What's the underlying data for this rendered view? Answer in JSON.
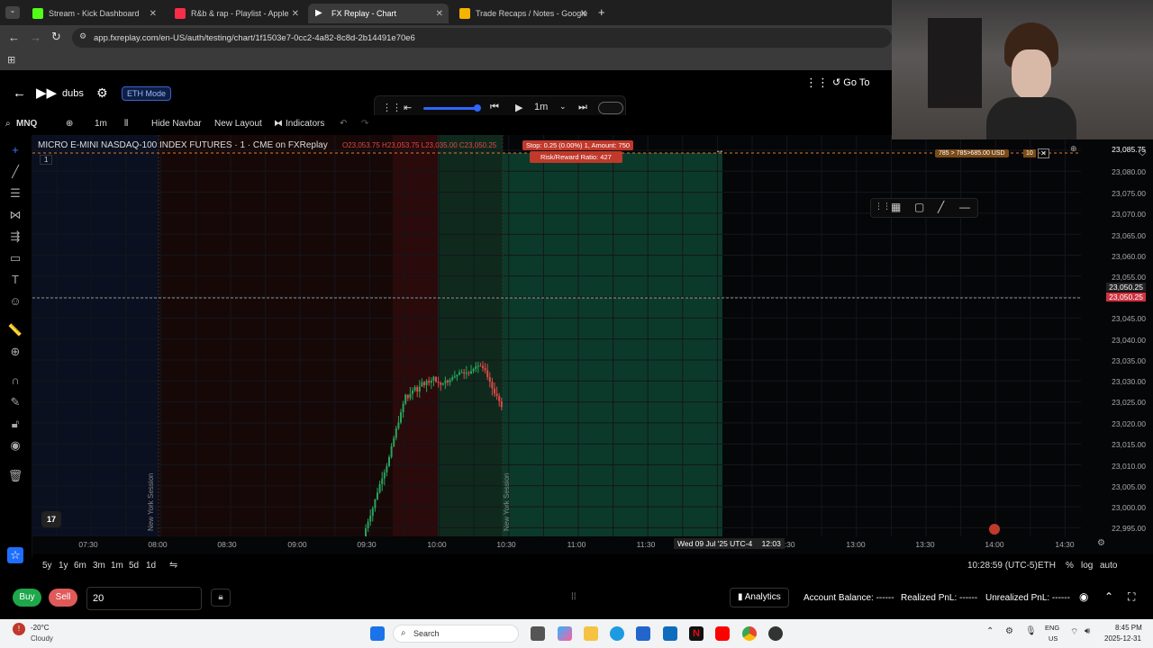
{
  "browser": {
    "tabs": [
      {
        "label": "Stream - Kick Dashboard",
        "color": "#53fc18"
      },
      {
        "label": "R&b & rap - Playlist - Apple",
        "color": "#fa2d48"
      },
      {
        "label": "FX Replay - Chart",
        "color": "#ffffff"
      },
      {
        "label": "Trade Recaps / Notes - Google",
        "color": "#f4b400"
      }
    ],
    "url": "app.fxreplay.com/en-US/auth/testing/chart/1f1503e7-0cc2-4a82-8c8d-2b14491e70e6"
  },
  "app": {
    "user": "dubs",
    "eth_mode": "ETH Mode",
    "goto": "Go To",
    "timeframe": "1m",
    "symbol_short": "MNQ",
    "tf_short": "1m",
    "hide_navbar": "Hide Navbar",
    "new_layout": "New Layout",
    "indicators": "Indicators"
  },
  "chart": {
    "title": "MICRO E-MINI NASDAQ-100 INDEX FUTURES · 1 · CME on FXReplay",
    "ohlc": "O23,053.75 H23,053.75 L23,035.00 C23,050.25",
    "stop_label": "Stop: 0.25 (0.00%) 1, Amount: 750",
    "rr_label": "Risk/Reward Ratio: 427",
    "position_tag": "785 > 785>685.00 USD",
    "qty_tag": "10",
    "session_label_1": "New York Session",
    "session_label_2": "New York Session",
    "pane_index": "1",
    "price_labels": [
      "23,085.75",
      "23,080.00",
      "23,075.00",
      "23,070.00",
      "23,065.00",
      "23,060.00",
      "23,055.00",
      "23,050.25",
      "23,050.25",
      "23,045.00",
      "23,040.00",
      "23,035.00",
      "23,030.00",
      "23,025.00",
      "23,020.00",
      "23,015.00",
      "23,010.00",
      "23,005.00",
      "23,000.00",
      "22,995.00"
    ],
    "time_labels": [
      "07:30",
      "08:00",
      "08:30",
      "09:00",
      "09:30",
      "10:00",
      "10:30",
      "11:00",
      "11:30",
      "12:30",
      "13:00",
      "13:30",
      "14:00",
      "14:30"
    ],
    "crosshair_time": "Wed 09 Jul '25 UTC-4",
    "crosshair_time2": "12:03"
  },
  "rangebar": {
    "ranges": [
      "5y",
      "1y",
      "6m",
      "3m",
      "1m",
      "5d",
      "1d"
    ],
    "clock": "10:28:59 (UTC-5)",
    "session": "ETH",
    "pct": "%",
    "log": "log",
    "auto": "auto"
  },
  "order": {
    "buy": "Buy",
    "sell": "Sell",
    "qty": "20",
    "analytics": "Analytics",
    "balance": "Account Balance: ------",
    "realized": "Realized PnL: ------",
    "unrealized": "Unrealized PnL: ------"
  },
  "taskbar": {
    "weather_temp": "-20°C",
    "weather_desc": "Cloudy",
    "search": "Search",
    "lang1": "ENG",
    "lang2": "US",
    "time": "8:45 PM",
    "date": "2025-12-31"
  }
}
